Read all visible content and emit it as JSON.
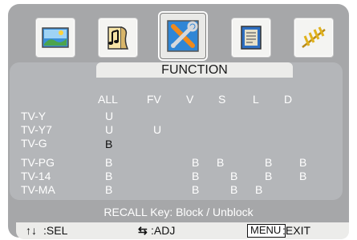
{
  "menu": {
    "title": "FUNCTION",
    "icons": [
      "picture-icon",
      "music-icon",
      "function-tools-icon",
      "info-icon",
      "antenna-icon"
    ],
    "selected_icon": "function-tools-icon"
  },
  "columns": [
    "ALL",
    "FV",
    "V",
    "S",
    "L",
    "D"
  ],
  "rows": [
    {
      "label": "TV-Y",
      "cells": [
        "U",
        "",
        "",
        "",
        "",
        ""
      ]
    },
    {
      "label": "TV-Y7",
      "cells": [
        "U",
        "U",
        "",
        "",
        "",
        ""
      ]
    },
    {
      "label": "TV-G",
      "cells": [
        "B",
        "",
        "",
        "",
        "",
        ""
      ]
    },
    {
      "label": "TV-PG",
      "cells": [
        "B",
        "",
        "B",
        "B",
        "B",
        "B"
      ]
    },
    {
      "label": "TV-14",
      "cells": [
        "B",
        "",
        "B",
        "B",
        "B",
        "B"
      ]
    },
    {
      "label": "TV-MA",
      "cells": [
        "B",
        "",
        "B",
        "B",
        "B",
        ""
      ]
    }
  ],
  "recall_hint": "RECALL Key: Block / Unblock",
  "footer": {
    "sel_arrows": "↑↓",
    "sel_label": ":SEL",
    "adj_arrows": "⇆",
    "adj_label": ":ADJ",
    "menu_key": "MENU",
    "exit_label": ":EXIT"
  }
}
